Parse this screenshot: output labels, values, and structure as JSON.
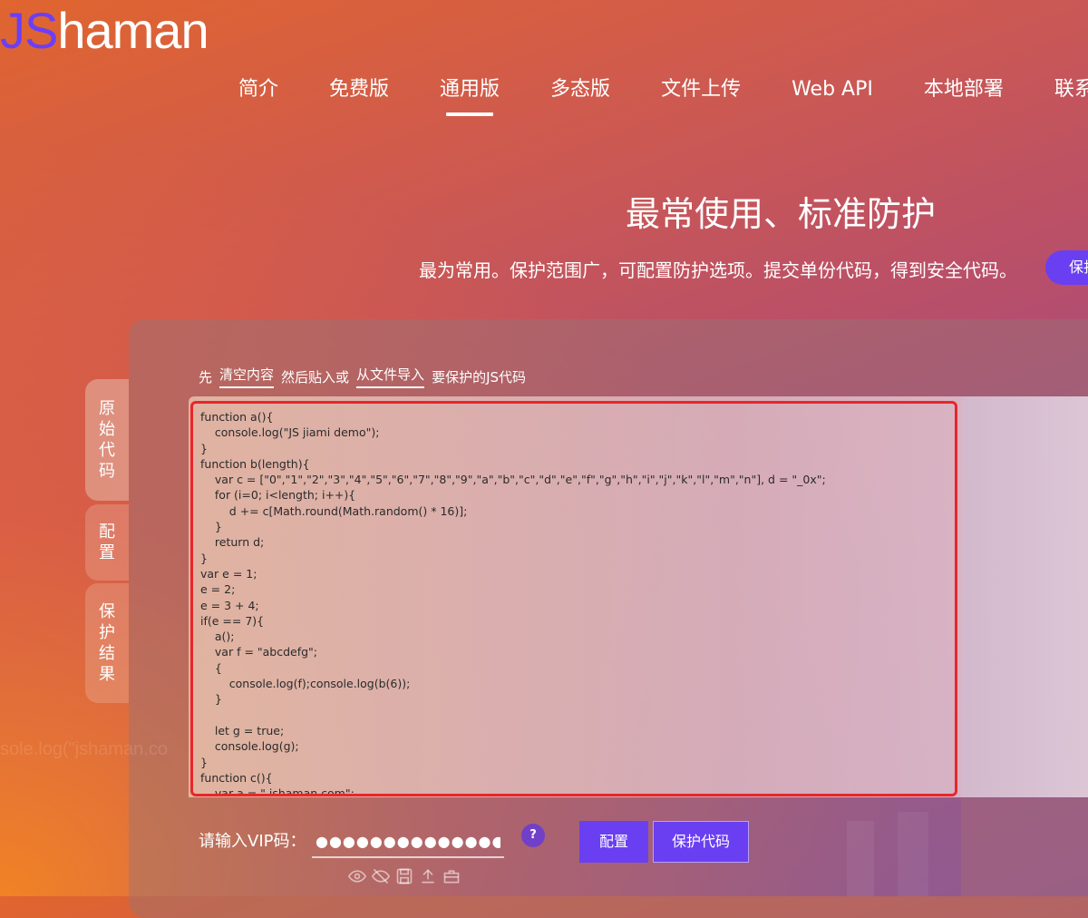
{
  "logo": {
    "js": "JS",
    "shaman": "haman"
  },
  "nav": [
    {
      "label": "简介"
    },
    {
      "label": "免费版"
    },
    {
      "label": "通用版",
      "active": true
    },
    {
      "label": "多态版"
    },
    {
      "label": "文件上传"
    },
    {
      "label": "Web API"
    },
    {
      "label": "本地部署"
    },
    {
      "label": "联系我们"
    }
  ],
  "hero": {
    "title": "最常使用、标准防护",
    "subtitle": "最为常用。保护范围广，可配置防护选项。提交单份代码，得到安全代码。",
    "button": "保护"
  },
  "side_tabs": {
    "original": [
      "原",
      "始",
      "代",
      "码"
    ],
    "config": [
      "配",
      "置"
    ],
    "result": [
      "保",
      "护",
      "结",
      "果"
    ]
  },
  "instructions": {
    "prefix": "先",
    "clear": "清空内容",
    "middle": "然后贴入或",
    "import": "从文件导入",
    "suffix": "要保护的JS代码"
  },
  "code_lines": [
    "function a(){",
    "    console.log(\"JS jiami demo\");",
    "}",
    "function b(length){",
    "    var c = [\"0\",\"1\",\"2\",\"3\",\"4\",\"5\",\"6\",\"7\",\"8\",\"9\",\"a\",\"b\",\"c\",\"d\",\"e\",\"f\",\"g\",\"h\",\"i\",\"j\",\"k\",\"l\",\"m\",\"n\"], d = \"_0x\";",
    "    for (i=0; i<length; i++){",
    "        d += c[Math.round(Math.random() * 16)];",
    "    }",
    "    return d;",
    "}",
    "var e = 1;",
    "e = 2;",
    "e = 3 + 4;",
    "if(e == 7){",
    "    a();",
    "    var f = \"abcdefg\";",
    "    {",
    "        console.log(f);console.log(b(6));",
    "    }",
    "",
    "    let g = true;",
    "    console.log(g);",
    "}",
    "function c(){",
    "    var a = \" jshaman.com\";"
  ],
  "ghost_text": "sole.log(\"jshaman.co",
  "vip": {
    "label": "请输入VIP码：",
    "value": "●●●●●●●●●●●●●●●●●●●●●"
  },
  "help_label": "?",
  "buttons": {
    "config": "配置",
    "protect": "保护代码"
  },
  "icons": [
    "eye-icon",
    "eye-off-icon",
    "save-icon",
    "upload-icon",
    "toolbox-icon"
  ],
  "colors": {
    "accent": "#6a3ff2",
    "highlight_border": "#e8262a"
  }
}
